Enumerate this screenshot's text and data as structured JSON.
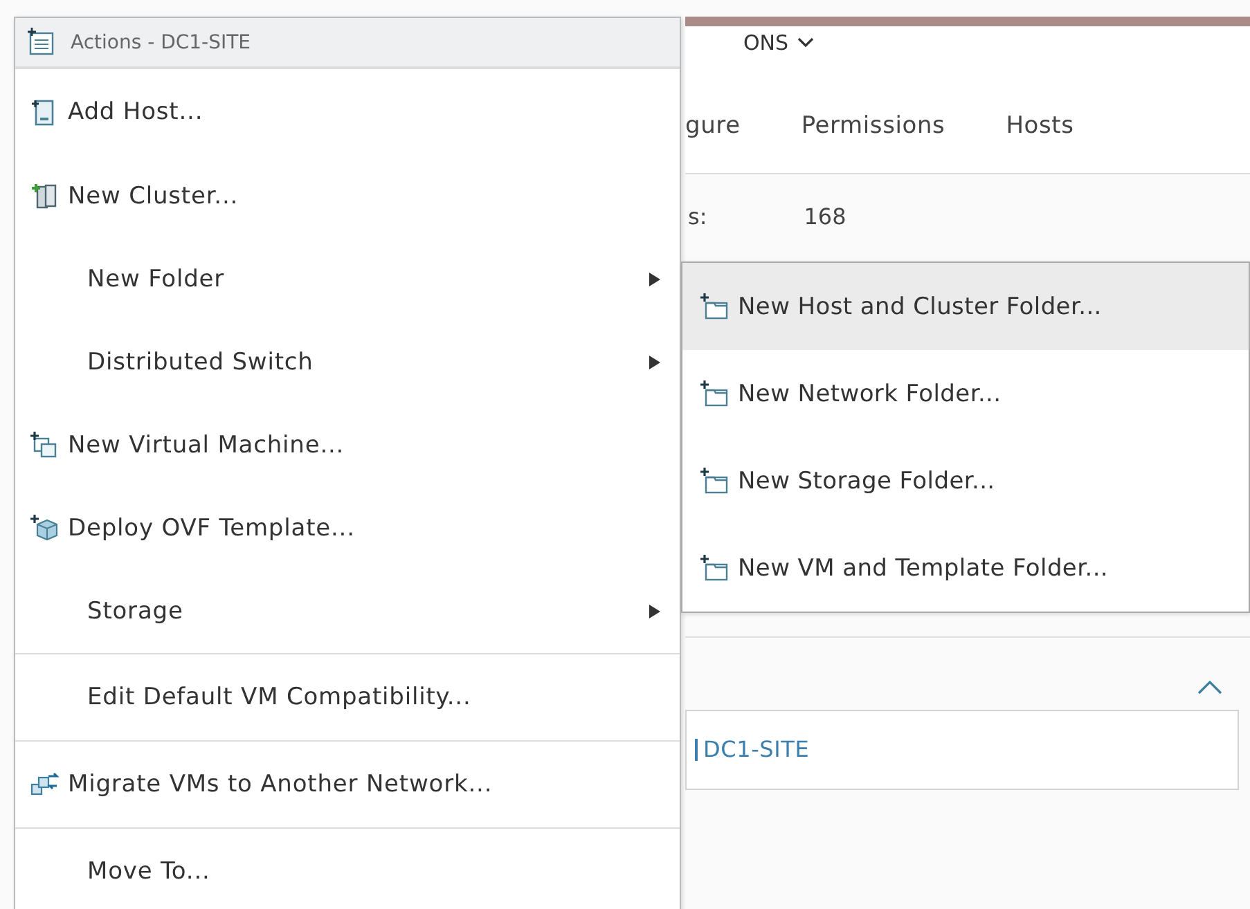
{
  "background": {
    "header_menu": "ONS",
    "tabs": [
      {
        "label": "gure"
      },
      {
        "label": "Permissions"
      },
      {
        "label": "Hosts"
      }
    ],
    "summary": {
      "label": "s:",
      "value": "168"
    },
    "section": {
      "expanded": true,
      "link": "DC1-SITE"
    }
  },
  "menu": {
    "title": "Actions - DC1-SITE",
    "items": [
      {
        "label": "Add Host...",
        "kind": "add-host",
        "submenu": false,
        "divider_before": true
      },
      {
        "label": "New Cluster...",
        "kind": "cluster",
        "submenu": false,
        "divider_before": false
      },
      {
        "label": "New Folder",
        "submenu": true,
        "divider_before": false
      },
      {
        "label": "Distributed Switch",
        "submenu": true,
        "divider_before": false
      },
      {
        "label": "New Virtual Machine...",
        "kind": "new-vm",
        "submenu": false,
        "divider_before": false
      },
      {
        "label": "Deploy OVF Template...",
        "kind": "deploy",
        "submenu": false,
        "divider_before": false
      },
      {
        "label": "Storage",
        "submenu": true,
        "divider_before": false
      },
      {
        "label": "Edit Default VM Compatibility...",
        "submenu": false,
        "divider_before": true
      },
      {
        "label": "Migrate VMs to Another Network...",
        "kind": "migrate",
        "submenu": false,
        "divider_before": true
      },
      {
        "label": "Move To...",
        "submenu": false,
        "divider_before": true
      }
    ]
  },
  "submenu": {
    "items": [
      {
        "label": "New Host and Cluster Folder...",
        "selected": true
      },
      {
        "label": "New Network Folder...",
        "selected": false
      },
      {
        "label": "New Storage Folder...",
        "selected": false
      },
      {
        "label": "New VM and Template Folder...",
        "selected": false
      }
    ]
  }
}
